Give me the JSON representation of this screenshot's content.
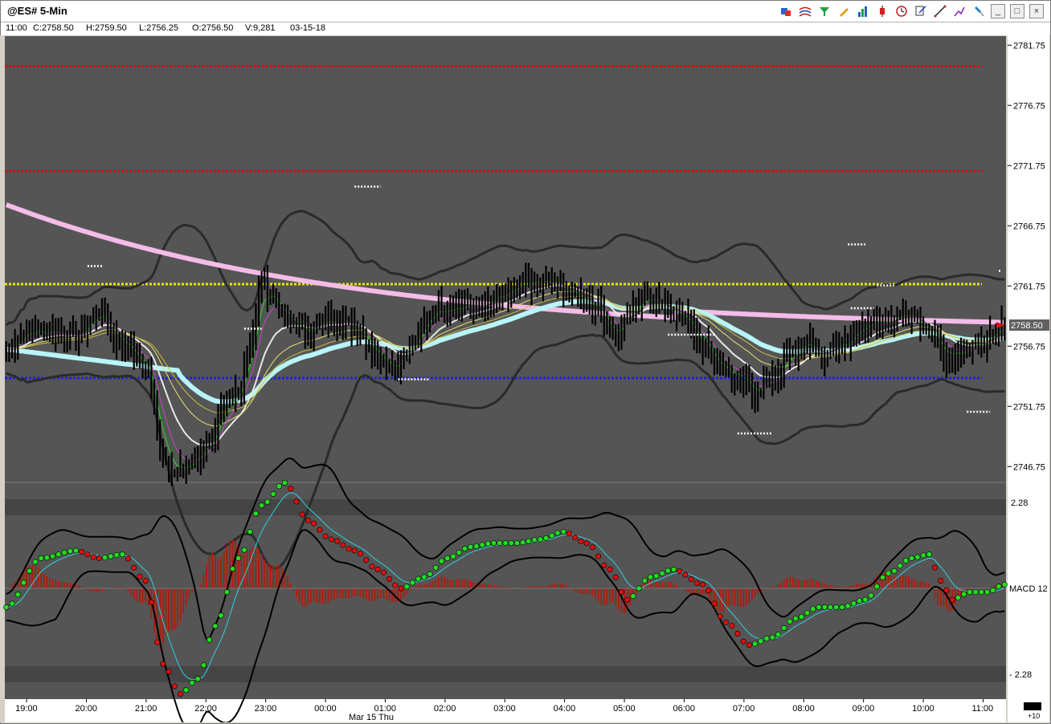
{
  "window": {
    "title": "@ES# 5-Min"
  },
  "toolbar": {
    "icons": [
      "insert-analysis-icon",
      "insert-indicator-icon",
      "insert-strategy-icon",
      "drawing-pen-icon",
      "chart-type-bar-icon",
      "candlestick-icon",
      "clock-icon",
      "format-icon",
      "trendline-icon",
      "tool-icon",
      "pin-icon"
    ],
    "minimize": "_",
    "maximize": "□",
    "close": "×"
  },
  "infobar": {
    "time": "11:00",
    "close": "C:2758.50",
    "high": "H:2759.50",
    "low": "L:2756.25",
    "open": "O:2756.50",
    "volume": "V:9,281",
    "date": "03-15-18"
  },
  "chart_data": [
    {
      "type": "bar",
      "subtype": "ohlc-price",
      "symbol": "@ES# 5-Min",
      "ylim": [
        2745.5,
        2782.5
      ],
      "yticks": [
        "2781.75",
        "2776.75",
        "2771.75",
        "2766.75",
        "2761.75",
        "2756.75",
        "2751.75",
        "2746.75"
      ],
      "last_price_label": "2758.50",
      "xticks": [
        "19:00",
        "20:00",
        "21:00",
        "22:00",
        "23:00",
        "00:00",
        "01:00",
        "02:00",
        "03:00",
        "04:00",
        "05:00",
        "06:00",
        "07:00",
        "08:00",
        "09:00",
        "10:00",
        "11:00"
      ],
      "date_label": "Mar 15 Thu",
      "horizontal_levels": [
        {
          "value": 2780.0,
          "color": "#c81414"
        },
        {
          "value": 2771.3,
          "color": "#c81414"
        },
        {
          "value": 2761.9,
          "color": "#e8e800"
        },
        {
          "value": 2754.1,
          "color": "#2020d0"
        }
      ],
      "close_path": [
        [
          0,
          2756.5
        ],
        [
          8,
          2758
        ],
        [
          16,
          2758
        ],
        [
          24,
          2757.5
        ],
        [
          32,
          2759.5
        ],
        [
          40,
          2757
        ],
        [
          48,
          2755
        ],
        [
          54,
          2748
        ],
        [
          58,
          2746
        ],
        [
          64,
          2747
        ],
        [
          70,
          2749
        ],
        [
          76,
          2752
        ],
        [
          80,
          2753
        ],
        [
          84,
          2757
        ],
        [
          88,
          2762
        ],
        [
          92,
          2761
        ],
        [
          96,
          2759
        ],
        [
          104,
          2758
        ],
        [
          112,
          2759
        ],
        [
          120,
          2758.5
        ],
        [
          128,
          2756
        ],
        [
          134,
          2755
        ],
        [
          140,
          2757
        ],
        [
          148,
          2760
        ],
        [
          156,
          2760
        ],
        [
          164,
          2760
        ],
        [
          172,
          2761
        ],
        [
          180,
          2762
        ],
        [
          188,
          2762
        ],
        [
          196,
          2761
        ],
        [
          204,
          2760
        ],
        [
          210,
          2757.5
        ],
        [
          216,
          2760
        ],
        [
          222,
          2761
        ],
        [
          228,
          2760
        ],
        [
          234,
          2759
        ],
        [
          240,
          2757
        ],
        [
          246,
          2755
        ],
        [
          252,
          2754
        ],
        [
          258,
          2753
        ],
        [
          264,
          2754
        ],
        [
          270,
          2756
        ],
        [
          276,
          2757
        ],
        [
          282,
          2756
        ],
        [
          288,
          2757
        ],
        [
          294,
          2758
        ],
        [
          300,
          2759
        ],
        [
          306,
          2759
        ],
        [
          312,
          2759.5
        ],
        [
          318,
          2758
        ],
        [
          324,
          2756
        ],
        [
          330,
          2756.5
        ],
        [
          336,
          2757
        ],
        [
          340,
          2757.5
        ],
        [
          344,
          2758.5
        ]
      ]
    },
    {
      "type": "line",
      "subtype": "macd",
      "label": "MACD 12",
      "yticks": [
        "2.28",
        "- 2.28"
      ],
      "path": [
        [
          0,
          -0.5
        ],
        [
          12,
          0.8
        ],
        [
          24,
          1.0
        ],
        [
          32,
          0.8
        ],
        [
          40,
          0.9
        ],
        [
          48,
          0.2
        ],
        [
          54,
          -2.0
        ],
        [
          60,
          -2.8
        ],
        [
          66,
          -2.4
        ],
        [
          72,
          -1.0
        ],
        [
          80,
          0.8
        ],
        [
          88,
          2.2
        ],
        [
          96,
          2.8
        ],
        [
          104,
          1.8
        ],
        [
          112,
          1.3
        ],
        [
          120,
          1.0
        ],
        [
          128,
          0.5
        ],
        [
          136,
          0
        ],
        [
          144,
          0.3
        ],
        [
          152,
          0.8
        ],
        [
          160,
          1.1
        ],
        [
          168,
          1.2
        ],
        [
          176,
          1.2
        ],
        [
          184,
          1.3
        ],
        [
          192,
          1.5
        ],
        [
          200,
          1.2
        ],
        [
          208,
          0.5
        ],
        [
          214,
          -0.3
        ],
        [
          222,
          0.3
        ],
        [
          230,
          0.5
        ],
        [
          240,
          0.1
        ],
        [
          248,
          -0.9
        ],
        [
          256,
          -1.5
        ],
        [
          264,
          -1.3
        ],
        [
          272,
          -0.8
        ],
        [
          280,
          -0.5
        ],
        [
          288,
          -0.5
        ],
        [
          296,
          -0.3
        ],
        [
          304,
          0.4
        ],
        [
          312,
          0.8
        ],
        [
          318,
          0.9
        ],
        [
          322,
          0.2
        ],
        [
          326,
          -0.3
        ],
        [
          332,
          -0.1
        ],
        [
          338,
          -0.1
        ],
        [
          344,
          0.1
        ]
      ]
    }
  ],
  "scroll_button": "+10"
}
